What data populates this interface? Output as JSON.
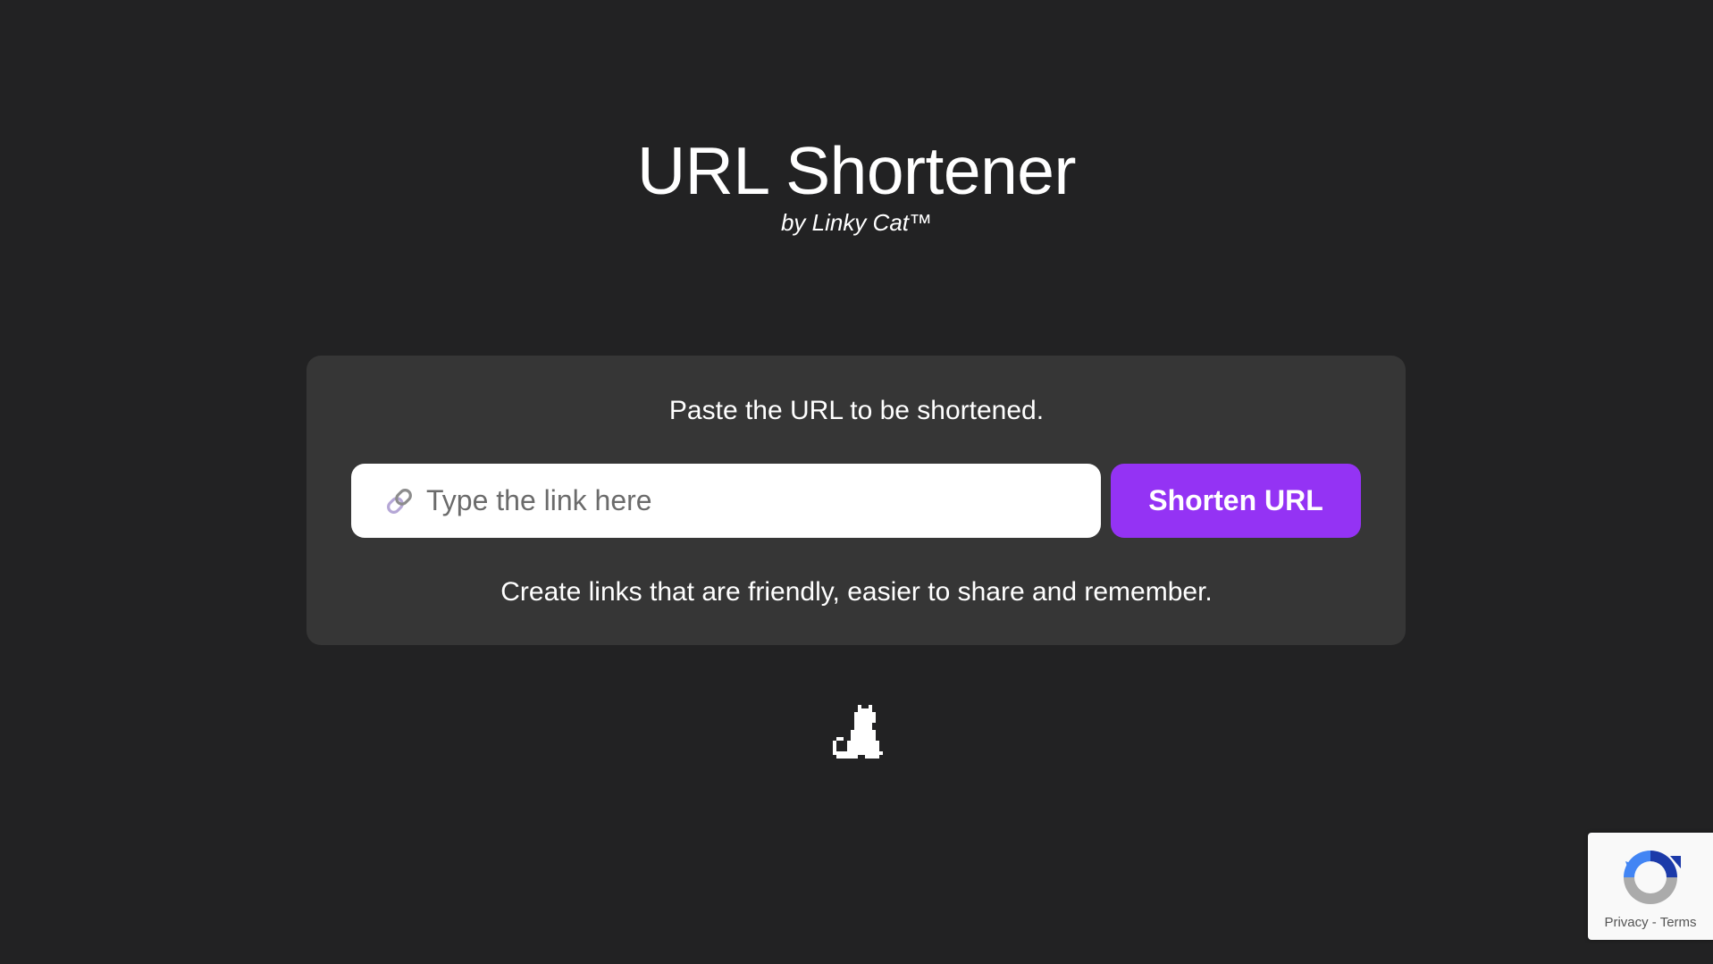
{
  "header": {
    "title": "URL Shortener",
    "subtitle": "by Linky Cat™"
  },
  "card": {
    "instruction": "Paste the URL to be shortened.",
    "input": {
      "placeholder": "Type the link here",
      "value": "",
      "icon": "link-icon"
    },
    "button_label": "Shorten URL",
    "tagline": "Create links that are friendly, easier to share and remember."
  },
  "mascot": {
    "icon": "pixel-cat-icon"
  },
  "recaptcha": {
    "icon": "recaptcha-logo-icon",
    "privacy_label": "Privacy",
    "separator": "-",
    "terms_label": "Terms"
  },
  "colors": {
    "background": "#222223",
    "card": "#363636",
    "accent": "#9433f4",
    "text": "#ffffff"
  }
}
